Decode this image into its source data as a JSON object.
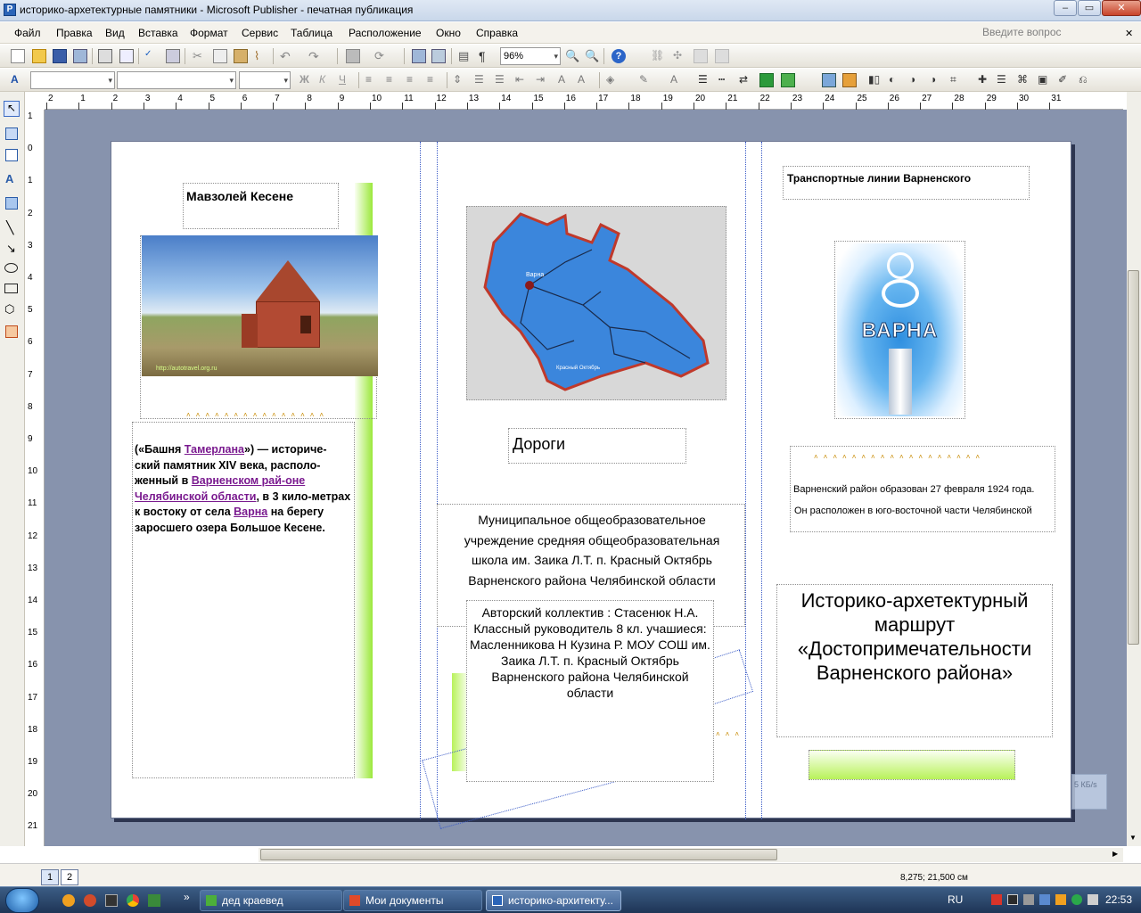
{
  "window": {
    "title": "историко-архетектурные памятники - Microsoft Publisher - печатная публикация"
  },
  "menu": {
    "items": [
      "Файл",
      "Правка",
      "Вид",
      "Вставка",
      "Формат",
      "Сервис",
      "Таблица",
      "Расположение",
      "Окно",
      "Справка"
    ],
    "help_placeholder": "Введите вопрос"
  },
  "toolbar": {
    "zoom": "96%"
  },
  "ruler": {
    "h": [
      "2",
      "1",
      "2",
      "3",
      "4",
      "5",
      "6",
      "7",
      "8",
      "9",
      "10",
      "11",
      "12",
      "13",
      "14",
      "15",
      "16",
      "17",
      "18",
      "19",
      "20",
      "21",
      "22",
      "23",
      "24",
      "25",
      "26",
      "27",
      "28",
      "29",
      "30",
      "31"
    ],
    "v": [
      "1",
      "0",
      "1",
      "2",
      "3",
      "4",
      "5",
      "6",
      "7",
      "8",
      "9",
      "10",
      "11",
      "12",
      "13",
      "14",
      "15",
      "16",
      "17",
      "18",
      "19",
      "20",
      "21"
    ]
  },
  "publication": {
    "panel1": {
      "heading": "Мавзолей Кесене",
      "photo_caption": "http://autotravel.org.ru",
      "body": {
        "t1": "(«Башня ",
        "link1": "Тамерлана",
        "t2": "») — историче-ский памятник XIV века, располо-женный в ",
        "link2": "Варненском рай-оне",
        "t3": " ",
        "link3": "Челябинской области",
        "t4": ", в 3 кило-метрах к востоку от села ",
        "link4": "Варна",
        "t5": " на берегу заросшего озера Большое Кесене."
      }
    },
    "panel2": {
      "map_labels": [
        "Варна",
        "Красный Октябрь"
      ],
      "heading": "Дороги",
      "school": "Муниципальное общеобразовательное учреждение средняя общеобразовательная школа им. Заика Л.Т. п. Красный Октябрь Варненского района Челябинской области",
      "authors": "Авторский коллектив  : Стасенюк Н.А. Классный руководитель 8 кл. учашиеся: Масленникова Н Кузина Р.  МОУ СОШ им. Заика Л.Т. п. Красный Октябрь Варненского района Челябинской области"
    },
    "panel3": {
      "heading": "Транспортные линии Варненского",
      "emblem_text": "ВАРНА",
      "info_line1": "Варненский район образован 27 февраля 1924 года.",
      "info_line2": "Он расположен в юго-восточной части Челябинской",
      "route_title": "Историко-архетектурный маршрут «Достопримечательности Варненского района»"
    }
  },
  "pages": [
    "1",
    "2"
  ],
  "status": {
    "coords": "8,275; 21,500 см",
    "size_badge": "5 КБ/s"
  },
  "taskbar": {
    "tasks": [
      "дед краевед",
      "Мои документы",
      "историко-архитекту..."
    ],
    "lang": "RU",
    "clock": "22:53"
  },
  "colors": {
    "canvas": "#8793ad",
    "link": "#7a1a8f",
    "accent_green": "#9be83b",
    "map_blue": "#2f7fd6"
  }
}
